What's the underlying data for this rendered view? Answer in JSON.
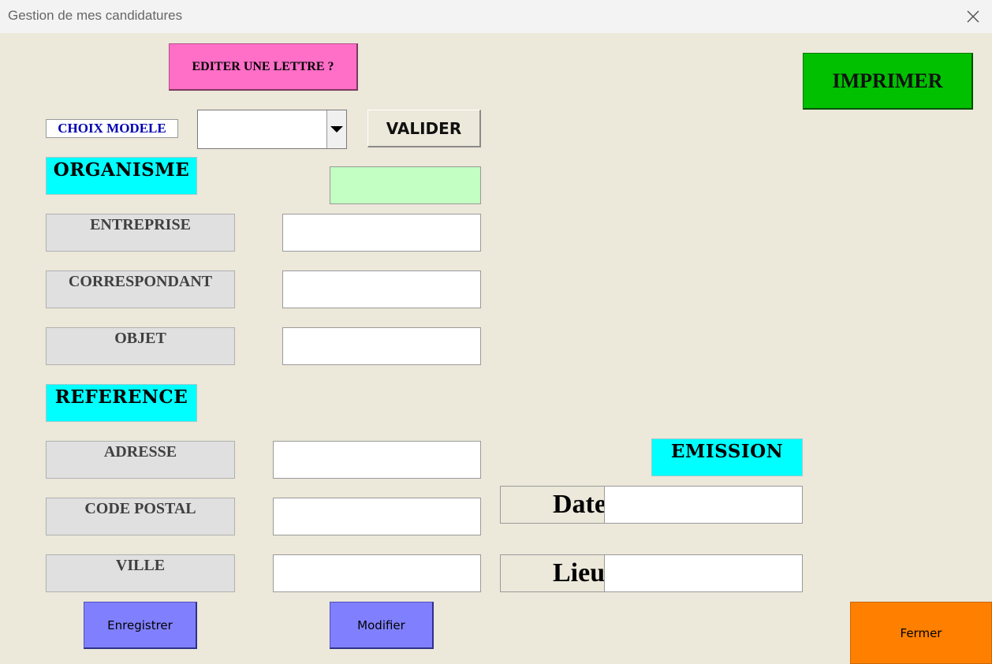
{
  "window": {
    "title": "Gestion de mes candidatures",
    "close_icon": "close-icon"
  },
  "buttons": {
    "edit_letter": "EDITER UNE LETTRE ?",
    "print": "IMPRIMER",
    "validate": "VALIDER",
    "save": "Enregistrer",
    "modify": "Modifier",
    "close": "Fermer"
  },
  "model_choice": {
    "label": "CHOIX MODELE",
    "selected": ""
  },
  "sections": {
    "organisme": "ORGANISME",
    "reference": "REFERENCE",
    "emission": "EMISSION"
  },
  "organisme_fields": [
    {
      "label": "ENTREPRISE",
      "value": ""
    },
    {
      "label": "CORRESPONDANT",
      "value": ""
    },
    {
      "label": "OBJET",
      "value": ""
    }
  ],
  "reference_fields": [
    {
      "label": "ADRESSE",
      "value": ""
    },
    {
      "label": "CODE POSTAL",
      "value": ""
    },
    {
      "label": "VILLE",
      "value": ""
    }
  ],
  "emission_fields": [
    {
      "label": "Date",
      "value": ""
    },
    {
      "label": "Lieu",
      "value": ""
    }
  ],
  "colors": {
    "background": "#ece8da",
    "edit_button": "#ff6ec7",
    "print_button": "#00c000",
    "section_header": "#00ffff",
    "status_box": "#c3ffc3",
    "action_buttons": "#8080ff",
    "close_button": "#ff8000",
    "choice_label_text": "#0000b0"
  }
}
